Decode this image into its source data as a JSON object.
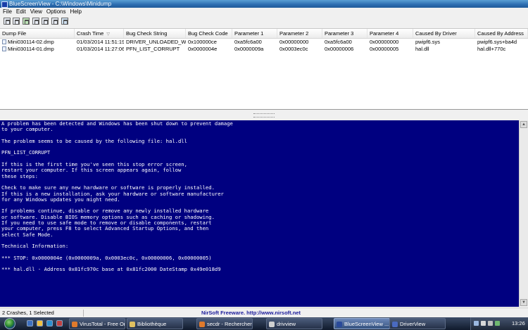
{
  "window": {
    "title": "BlueScreenView  -  C:\\Windows\\Minidump"
  },
  "menu": [
    "File",
    "Edit",
    "View",
    "Options",
    "Help"
  ],
  "toolbar": {
    "icons": [
      "save-icon",
      "copy-icon",
      "html-report-icon",
      "properties-icon",
      "refresh-icon",
      "options-icon",
      "exit-icon"
    ]
  },
  "list": {
    "columns": [
      "Dump File",
      "Crash Time",
      "Bug Check String",
      "Bug Check Code",
      "Parameter 1",
      "Parameter 2",
      "Parameter 3",
      "Parameter 4",
      "Caused By Driver",
      "Caused By Address"
    ],
    "sort_indicator": "▽",
    "rows": [
      [
        "Mini030114-02.dmp",
        "01/03/2014 11:51:19",
        "DRIVER_UNLOADED_WI...",
        "0x100000ce",
        "0xa5fc6a00",
        "0x00000000",
        "0xa5fc6a00",
        "0x00000000",
        "pwipf6.sys",
        "pwipf6.sys+ba4d"
      ],
      [
        "Mini030114-01.dmp",
        "01/03/2014 11:27:06",
        "PFN_LIST_CORRUPT",
        "0x0000004e",
        "0x0000009a",
        "0x0003ec0c",
        "0x00000006",
        "0x00000005",
        "hal.dll",
        "hal.dll+770c"
      ]
    ]
  },
  "bsod": {
    "background_color": "#000080",
    "lines": [
      "A problem has been detected and Windows has been shut down to prevent damage",
      "to your computer.",
      "",
      "The problem seems to be caused by the following file: hal.dll",
      "",
      "PFN_LIST_CORRUPT",
      "",
      "If this is the first time you've seen this stop error screen,",
      "restart your computer. If this screen appears again, follow",
      "these steps:",
      "",
      "Check to make sure any new hardware or software is properly installed.",
      "If this is a new installation, ask your hardware or software manufacturer",
      "for any Windows updates you might need.",
      "",
      "If problems continue, disable or remove any newly installed hardware",
      "or software. Disable BIOS memory options such as caching or shadowing.",
      "If you need to use safe mode to remove or disable components, restart",
      "your computer, press F8 to select Advanced Startup Options, and then",
      "select Safe Mode.",
      "",
      "Technical Information:",
      "",
      "*** STOP: 0x0000004e (0x0000009a, 0x0003ec0c, 0x00000006, 0x00000005)",
      "",
      "*** hal.dll - Address 0x81fc970c base at 0x81fc2000 DateStamp 0x49e018d9"
    ]
  },
  "status": {
    "count": "2 Crashes, 1 Selected",
    "credit": "NirSoft Freeware.  http://www.nirsoft.net"
  },
  "taskbar": {
    "tasks": [
      {
        "label": "VirusTotal - Free On...",
        "icon": "firefox-icon"
      },
      {
        "label": "Bibliothèque",
        "icon": "folder-icon"
      },
      {
        "label": "secdr - Rechercher ...",
        "icon": "firefox-icon"
      },
      {
        "label": "drivview",
        "icon": "document-icon"
      },
      {
        "label": "BlueScreenView ...",
        "icon": "bluescreenview-icon"
      },
      {
        "label": "DriverView",
        "icon": "driverview-icon"
      }
    ],
    "clock": "13:26"
  }
}
